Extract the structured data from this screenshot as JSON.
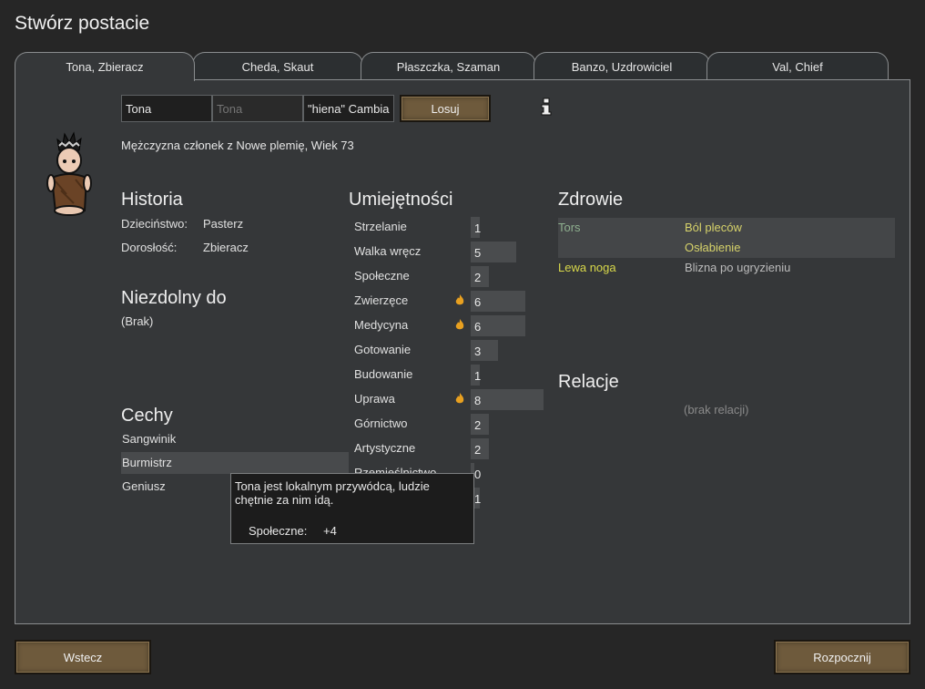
{
  "title": "Stwórz postacie",
  "tabs": [
    {
      "label": "Tona, Zbieracz"
    },
    {
      "label": "Cheda, Skaut"
    },
    {
      "label": "Płaszczka, Szaman"
    },
    {
      "label": "Banzo, Uzdrowiciel"
    },
    {
      "label": "Val, Chief"
    }
  ],
  "name_fields": {
    "first": "Tona",
    "nick_placeholder": "Tona",
    "last": "\"hiena\" Cambia"
  },
  "randomize_label": "Losuj",
  "description": "Mężczyzna członek z Nowe plemię, Wiek 73",
  "backstory": {
    "heading": "Historia",
    "childhood_label": "Dzieciństwo:",
    "childhood_value": "Pasterz",
    "adulthood_label": "Dorosłość:",
    "adulthood_value": "Zbieracz"
  },
  "incapable": {
    "heading": "Niezdolny do",
    "value": "(Brak)"
  },
  "traits": {
    "heading": "Cechy",
    "items": [
      "Sangwinik",
      "Burmistrz",
      "Geniusz"
    ]
  },
  "skills": {
    "heading": "Umiejętności",
    "max_level": 20,
    "items": [
      {
        "name": "Strzelanie",
        "level": 1,
        "passion": false
      },
      {
        "name": "Walka wręcz",
        "level": 5,
        "passion": false
      },
      {
        "name": "Społeczne",
        "level": 2,
        "passion": false
      },
      {
        "name": "Zwierzęce",
        "level": 6,
        "passion": true
      },
      {
        "name": "Medycyna",
        "level": 6,
        "passion": true
      },
      {
        "name": "Gotowanie",
        "level": 3,
        "passion": false
      },
      {
        "name": "Budowanie",
        "level": 1,
        "passion": false
      },
      {
        "name": "Uprawa",
        "level": 8,
        "passion": true
      },
      {
        "name": "Górnictwo",
        "level": 2,
        "passion": false
      },
      {
        "name": "Artystyczne",
        "level": 2,
        "passion": false
      },
      {
        "name": "Rzemieślnictwo",
        "level": 0,
        "passion": false
      },
      {
        "name": "",
        "level": 1,
        "passion": false
      }
    ]
  },
  "health": {
    "heading": "Zdrowie",
    "rows": [
      {
        "part": "Tors",
        "condition": "Ból pleców",
        "part_color": "#8fb08f",
        "cond_color": "#d6d26a"
      },
      {
        "part": "",
        "condition": "Osłabienie",
        "part_color": "#8fb08f",
        "cond_color": "#d6d26a"
      },
      {
        "part": "Lewa noga",
        "condition": "Blizna po ugryzieniu",
        "part_color": "#d8d84a",
        "cond_color": "#bbbbbb"
      }
    ]
  },
  "relations": {
    "heading": "Relacje",
    "empty": "(brak relacji)"
  },
  "tooltip": {
    "text": "Tona jest lokalnym przywódcą, ludzie chętnie za nim idą.",
    "stat_label": "Społeczne:",
    "stat_value": "+4"
  },
  "buttons": {
    "back": "Wstecz",
    "start": "Rozpocznij"
  },
  "colors": {
    "button": "#6e5a3c",
    "passion": "#e8a020",
    "panel": "#353739"
  }
}
